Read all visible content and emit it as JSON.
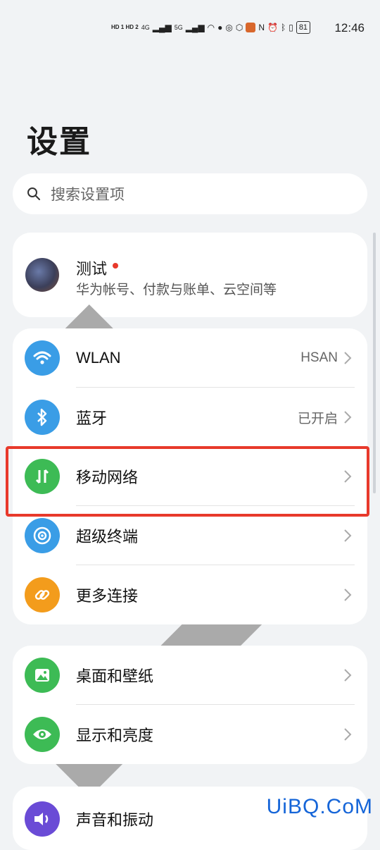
{
  "status_bar": {
    "hd1": "HD 1",
    "hd2": "HD 2",
    "net1": "4G",
    "net2": "5G",
    "battery": "81",
    "time": "12:46",
    "icons": [
      "signal-icon",
      "wifi-icon",
      "wechat-icon",
      "weibo-icon",
      "app-icon",
      "game-icon",
      "nfc-icon",
      "alarm-icon",
      "bluetooth-icon",
      "vibrate-icon"
    ]
  },
  "page": {
    "title": "设置"
  },
  "search": {
    "placeholder": "搜索设置项"
  },
  "account": {
    "name": "测试",
    "subtitle": "华为帐号、付款与账单、云空间等"
  },
  "connectivity": [
    {
      "label": "WLAN",
      "value": "HSAN",
      "icon": "wifi-icon",
      "color": "#3a9de6"
    },
    {
      "label": "蓝牙",
      "value": "已开启",
      "icon": "bluetooth-icon",
      "color": "#3a9de6"
    },
    {
      "label": "移动网络",
      "value": "",
      "icon": "mobile-data-icon",
      "color": "#3dbb55"
    },
    {
      "label": "超级终端",
      "value": "",
      "icon": "super-device-icon",
      "color": "#3a9de6"
    },
    {
      "label": "更多连接",
      "value": "",
      "icon": "link-icon",
      "color": "#f39c1c"
    }
  ],
  "display": [
    {
      "label": "桌面和壁纸",
      "icon": "wallpaper-icon",
      "color": "#3dbb55"
    },
    {
      "label": "显示和亮度",
      "icon": "eye-icon",
      "color": "#3dbb55"
    }
  ],
  "sound": [
    {
      "label": "声音和振动",
      "icon": "speaker-icon",
      "color": "#6a4bd6"
    }
  ],
  "watermark": "UiBQ.CoM",
  "highlight_color": "#e8392b"
}
